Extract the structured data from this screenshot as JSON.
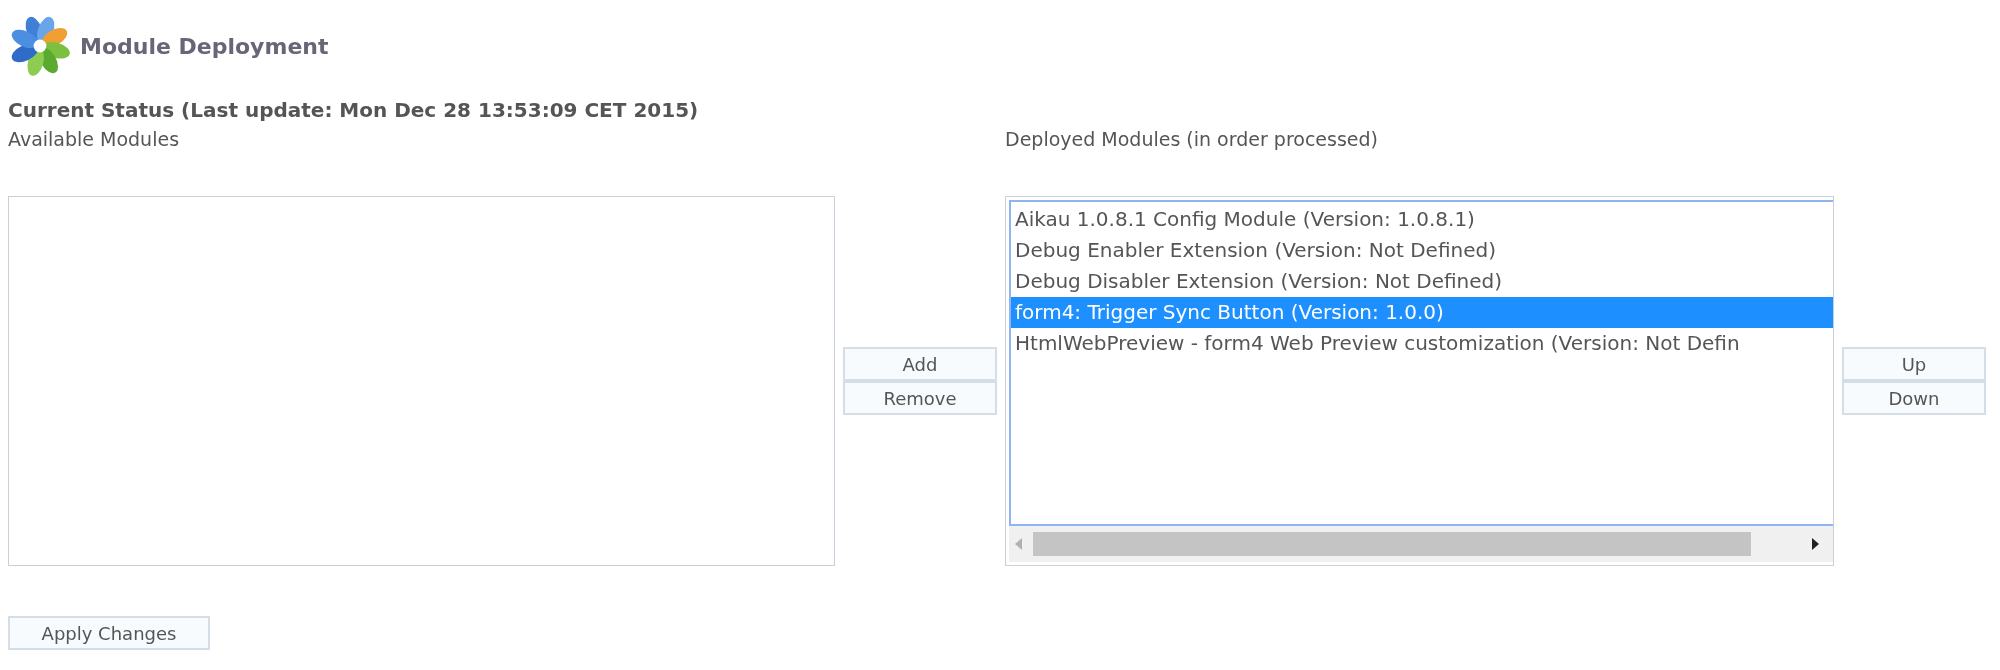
{
  "header": {
    "title": "Module Deployment"
  },
  "status": "Current Status (Last update: Mon Dec 28 13:53:09 CET 2015)",
  "available": {
    "label": "Available Modules"
  },
  "transfer_buttons": [
    "Add",
    "Remove"
  ],
  "deployed": {
    "label": "Deployed Modules (in order processed)",
    "items": [
      {
        "text": "Aikau 1.0.8.1 Config Module (Version: 1.0.8.1)",
        "selected": false
      },
      {
        "text": "Debug Enabler Extension (Version: Not Defined)",
        "selected": false
      },
      {
        "text": "Debug Disabler Extension (Version: Not Defined)",
        "selected": false
      },
      {
        "text": "form4: Trigger Sync Button (Version: 1.0.0)",
        "selected": true
      },
      {
        "text": "HtmlWebPreview - form4 Web Preview customization (Version: Not Defin",
        "selected": false
      }
    ]
  },
  "order_buttons": [
    "Up",
    "Down"
  ],
  "apply_button": "Apply Changes"
}
